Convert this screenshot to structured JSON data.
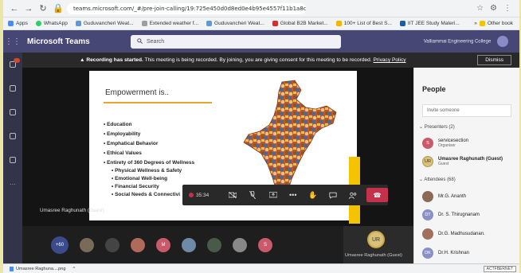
{
  "browser": {
    "url": "teams.microsoft.com/_#/pre-join-calling/19:725e450d0d8ed0e4b95e4557f11b1a8c7@thread.tacv2",
    "bookmarks": [
      {
        "label": "Apps",
        "color": "#4c8bf5"
      },
      {
        "label": "WhatsApp",
        "color": "#25d366"
      },
      {
        "label": "Guduvancheri Weat...",
        "color": "#5b9bd5"
      },
      {
        "label": "Extended weather f...",
        "color": "#9e9e9e"
      },
      {
        "label": "Guduvancheri Weat...",
        "color": "#5b9bd5"
      },
      {
        "label": "Global B2B Market...",
        "color": "#d32f2f"
      },
      {
        "label": "100+ List of Best S...",
        "color": "#f4b400"
      },
      {
        "label": "IIT JEE Study Materi...",
        "color": "#1e5aa8"
      }
    ],
    "bookmarks_more": "»",
    "other_bookmarks": "Other book"
  },
  "teams": {
    "title": "Microsoft Teams",
    "search_placeholder": "Search",
    "org": "Valliammai Engineering College"
  },
  "banner": {
    "bold": "Recording has started.",
    "text": " This meeting is being recorded. By joining, you are giving consent for this meeting to be recorded. ",
    "link": "Privacy Policy",
    "dismiss": "Dismiss"
  },
  "slide": {
    "title": "Empowerment is..",
    "items": [
      "Education",
      "Employability",
      "Emphatical Behavior",
      "Ethical Values",
      "Entirety of 360 Degrees of Wellness"
    ],
    "subitems": [
      "Physical Wellness & Safety",
      "Emotional Well-being",
      "Financial Security",
      "Social Needs & Connectivi"
    ]
  },
  "stage": {
    "presenter_label": "Umasree Raghunath (Guest)",
    "timer": "35:34"
  },
  "strip": {
    "more_count": "+60",
    "self_initials": "UR",
    "self_name": "Umasree Raghunath (Guest)",
    "avatars": [
      {
        "initials": "",
        "color": "#7a6a58"
      },
      {
        "initials": "",
        "color": "#444"
      },
      {
        "initials": "",
        "color": "#b06a5a"
      },
      {
        "initials": "M",
        "color": "#c95a6a"
      },
      {
        "initials": "",
        "color": "#6f8aa8"
      },
      {
        "initials": "",
        "color": "#4a5a4a"
      },
      {
        "initials": "",
        "color": "#888"
      },
      {
        "initials": "S",
        "color": "#c95a6a"
      }
    ]
  },
  "people": {
    "title": "People",
    "invite": "Invite someone",
    "presenters_header": "Presenters (2)",
    "presenters": [
      {
        "initials": "S",
        "name": "servicesection",
        "role": "Organiser",
        "color": "#c95a6a",
        "bold": false
      },
      {
        "initials": "UR",
        "name": "Umasree Raghunath (Guest)",
        "role": "Guest",
        "color": "#d9c07a",
        "bold": true
      }
    ],
    "attendees_header": "Attendees (68)",
    "attendees": [
      {
        "initials": "",
        "name": "Mr.G. Ananth",
        "color": "#8a6a55"
      },
      {
        "initials": "DT",
        "name": "Dr. S. Thirugnanam",
        "color": "#8a8fc4"
      },
      {
        "initials": "",
        "name": "Dr.G. Madhusudanan.",
        "color": "#a0705a"
      },
      {
        "initials": "DK",
        "name": "Dr.H. Krishnan",
        "color": "#8a8fc4"
      }
    ]
  },
  "download": {
    "file": "Umasree Raghuna....png",
    "chevron": "^",
    "show_all": "ACTFBERNET"
  }
}
